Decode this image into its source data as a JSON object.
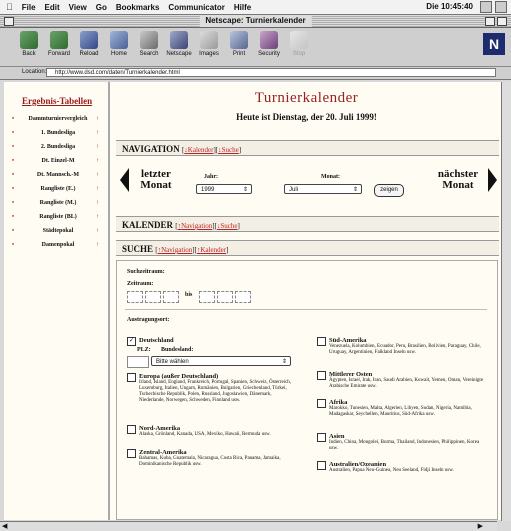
{
  "menubar": {
    "items": [
      "File",
      "Edit",
      "View",
      "Go",
      "Bookmarks",
      "Communicator",
      "Hilfe"
    ],
    "clock": "Die 10:45:40"
  },
  "window": {
    "title": "Netscape: Turnierkalender"
  },
  "toolbar": {
    "buttons": [
      "Back",
      "Forward",
      "Reload",
      "Home",
      "Search",
      "Netscape",
      "Images",
      "Print",
      "Security",
      "Stop"
    ],
    "logo": "N"
  },
  "location": {
    "label": "Location:",
    "url": "http://www.dsd.com/daten/Turnierkalender.html"
  },
  "leftnav": {
    "header": "Ergebnis-Tabellen",
    "items": [
      "Dammturniervergleich",
      "1. Bundesliga",
      "2. Bundesliga",
      "Dt. Einzel-M",
      "Dt. Mannsch.-M",
      "Rangliste (E.)",
      "Rangliste (M.)",
      "Rangliste (BL)",
      "Städtepokal",
      "Damenpokal"
    ]
  },
  "main": {
    "title": "Turnierkalender",
    "date_line": "Heute ist Dienstag, der 20. Juli 1999!",
    "navigation": {
      "heading": "NAVIGATION",
      "link1": "Kalender",
      "link2": "Suche",
      "prev_label": "letzter Monat",
      "next_label": "nächster Monat",
      "year_label": "Jahr:",
      "year_value": "1999",
      "month_label": "Monat:",
      "month_value": "Juli",
      "show_button": "zeigen"
    },
    "calendar": {
      "heading": "KALENDER",
      "link1": "Navigation",
      "link2": "Suche"
    },
    "search": {
      "heading": "SUCHE",
      "link1": "Navigation",
      "link2": "Kalender",
      "period_heading": "Suchzeitraum:",
      "timespan_label": "Zeitraum:",
      "bis_label": "bis",
      "venue_heading": "Austragungsort:",
      "germany_label": "Deutschland",
      "plz_label": "PLZ:",
      "state_label": "Bundesland:",
      "state_placeholder": "Bitte wählen",
      "left_regions": [
        {
          "title": "Europa (außer Deutschland)",
          "desc": "Irland, Island, England, Frankreich, Portugal, Spanien, Schweiz, Österreich, Luxemburg, Italien, Ungarn, Rumänien, Bulgarien, Griechenland, Türkei, Tschechische Republik, Polen, Russland, Jugoslawien, Dänemark, Niederlande, Norwegen, Schweden, Finnland usw."
        },
        {
          "title": "Nord-Amerika",
          "desc": "Alaska, Grönland, Kanada, USA, Mexiko, Hawaii, Bermuda usw."
        },
        {
          "title": "Zentral-Amerika",
          "desc": "Bahamas, Kuba, Guatemala, Nicaragua, Costa Rica, Panama, Jamaika, Dominikanische Republik usw."
        }
      ],
      "right_regions": [
        {
          "title": "Süd-Amerika",
          "desc": "Venezuela, Kolumbien, Ecuador, Peru, Brasilien, Bolivien, Paraguay, Chile, Uruguay, Argentinien, Falkland Inseln usw."
        },
        {
          "title": "Mittlerer Osten",
          "desc": "Ägypten, Israel, Irak, Iran, Saudi Arabien, Kuwait, Yemen, Oman, Vereinigte Arabische Emirate usw."
        },
        {
          "title": "Afrika",
          "desc": "Marokko, Tunesien, Malta, Algerien, Libyen, Sudan, Nigeria, Namibia, Madagaskar, Seychellen, Mauritius, Süd-Afrika usw."
        },
        {
          "title": "Asien",
          "desc": "Indien, China, Mongolei, Burma, Thailand, Indonesien, Philippinen, Korea usw."
        },
        {
          "title": "Australien/Ozeanien",
          "desc": "Australien, Papua Neu-Guinea, Neu Seeland, Fidji Inseln usw."
        }
      ]
    }
  },
  "colors": {
    "accent": "#9a2222",
    "link": "#c02020",
    "page_bg": "#fefcf3",
    "chrome": "#cfcfcf"
  }
}
